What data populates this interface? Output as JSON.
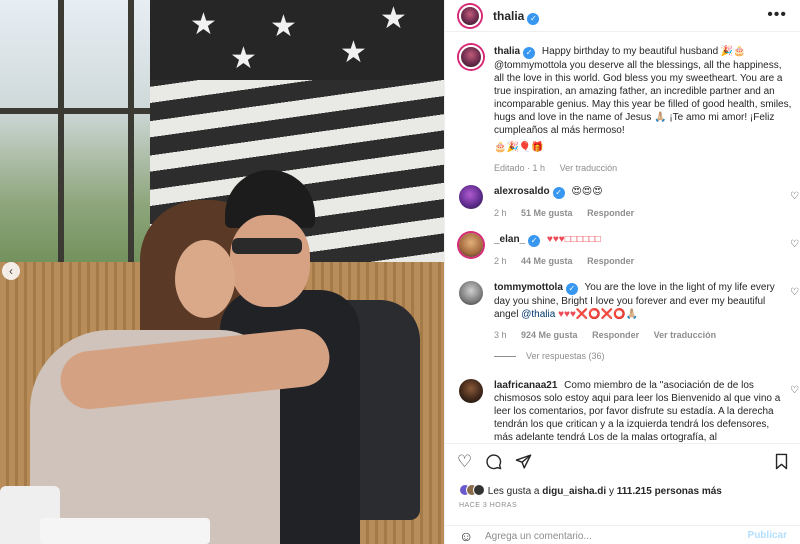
{
  "post": {
    "username": "thalia",
    "more_label": "•••",
    "prev_label": "‹"
  },
  "caption": {
    "username": "thalia",
    "text": "Happy birthday to my beautiful husband 🎉🎂 @tommymottola you deserve all the blessings, all the happiness, all the love in this world. God bless you my sweetheart. You are a true inspiration, an amazing father, an incredible partner and an incomparable genius. May this year be filled of good health, smiles, hugs and love in the name of Jesus 🙏🏼 ¡Te amo mi amor! ¡Feliz cumpleaños al más hermoso!",
    "emojis": "🎂🎉🎈🎁",
    "edited": "Editado · 1 h",
    "translate": "Ver traducción"
  },
  "comments": [
    {
      "username": "alexrosaldo",
      "verified": true,
      "text": "😍😍😍",
      "time": "2 h",
      "likes": "51 Me gusta",
      "reply": "Responder"
    },
    {
      "username": "_elan_",
      "verified": true,
      "text": "♥♥♥□□□□□□",
      "time": "2 h",
      "likes": "44 Me gusta",
      "reply": "Responder"
    },
    {
      "username": "tommymottola",
      "verified": true,
      "text": "You are the love in the light of my life every day you shine, Bright I love you forever and ever my beautiful angel",
      "mention": "@thalia",
      "emojis": "♥♥♥❌⭕❌⭕🙏🏼",
      "time": "3 h",
      "likes": "924 Me gusta",
      "reply": "Responder",
      "translate": "Ver traducción"
    },
    {
      "username": "laafricanaa21",
      "verified": false,
      "text": "Como miembro de la \"asociación de de los chismosos solo estoy aqui para leer los Bienvenido al que vino a leer los comentarios, por favor disfrute su estadía. A la derecha tendrán los que critican y a la izquierda tendrá los defensores, más adelante tendrá Los de la malas ortografía, al"
    }
  ],
  "view_replies": "Ver respuestas (36)",
  "likes": {
    "prefix": "Les gusta a",
    "user": "digu_aisha.di",
    "middle": "y",
    "count": "111.215 personas más"
  },
  "time_ago": "HACE 3 HORAS",
  "comment_box": {
    "placeholder": "Agrega un comentario...",
    "publish": "Publicar"
  },
  "icons": {
    "like": "heart-icon",
    "comment": "comment-icon",
    "share": "share-icon",
    "save": "bookmark-icon",
    "emoji": "emoji-icon"
  },
  "colors": {
    "verified": "#3897f0",
    "mention": "#00376b",
    "muted": "#8e8e8e",
    "publish_disabled": "#b2dffc",
    "heart": "#ed4956"
  }
}
